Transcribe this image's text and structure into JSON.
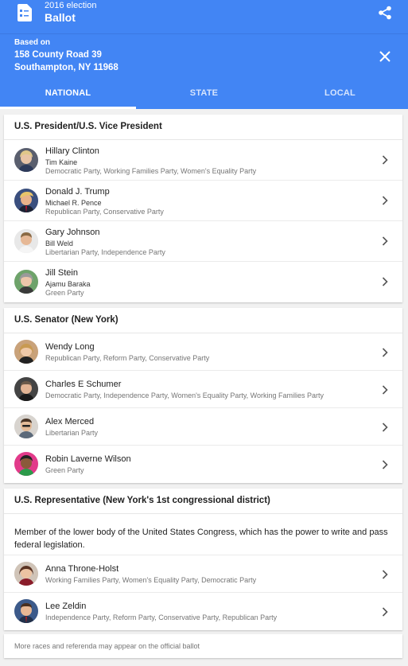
{
  "app": {
    "subtitle": "2016 election",
    "title": "Ballot"
  },
  "address": {
    "label": "Based on",
    "line1": "158 County Road 39",
    "line2": "Southampton, NY 11968"
  },
  "tabs": [
    {
      "label": "NATIONAL",
      "active": true
    },
    {
      "label": "STATE",
      "active": false
    },
    {
      "label": "LOCAL",
      "active": false
    }
  ],
  "president": {
    "title": "U.S. President/U.S. Vice President",
    "candidates": [
      {
        "name": "Hillary Clinton",
        "running_mate": "Tim Kaine",
        "parties": "Democratic Party, Working Families Party, Women's Equality Party"
      },
      {
        "name": "Donald J. Trump",
        "running_mate": "Michael R. Pence",
        "parties": "Republican Party, Conservative Party"
      },
      {
        "name": "Gary Johnson",
        "running_mate": "Bill Weld",
        "parties": "Libertarian Party, Independence Party"
      },
      {
        "name": "Jill Stein",
        "running_mate": "Ajamu Baraka",
        "parties": "Green Party"
      }
    ]
  },
  "senator": {
    "title": "U.S. Senator (New York)",
    "candidates": [
      {
        "name": "Wendy Long",
        "parties": "Republican Party, Reform Party, Conservative Party"
      },
      {
        "name": "Charles E Schumer",
        "parties": "Democratic Party, Independence Party, Women's Equality Party, Working Families Party"
      },
      {
        "name": "Alex Merced",
        "parties": "Libertarian Party"
      },
      {
        "name": "Robin Laverne Wilson",
        "parties": "Green Party"
      }
    ]
  },
  "representative": {
    "title": "U.S. Representative (New York's 1st congressional district)",
    "description": "Member of the lower body of the United States Congress, which has the power to write and pass federal legislation.",
    "candidates": [
      {
        "name": "Anna Throne-Holst",
        "parties": "Working Families Party, Women's Equality Party, Democratic Party"
      },
      {
        "name": "Lee Zeldin",
        "parties": "Independence Party, Reform Party, Conservative Party, Republican Party"
      }
    ]
  },
  "footer": {
    "note": "More races and referenda may appear on the official ballot"
  },
  "colors": {
    "header_blue": "#4285f4",
    "background": "#f1f1f1"
  },
  "icons": [
    "ballot-icon",
    "share-icon",
    "close-icon",
    "chevron-right-icon",
    "avatar"
  ]
}
